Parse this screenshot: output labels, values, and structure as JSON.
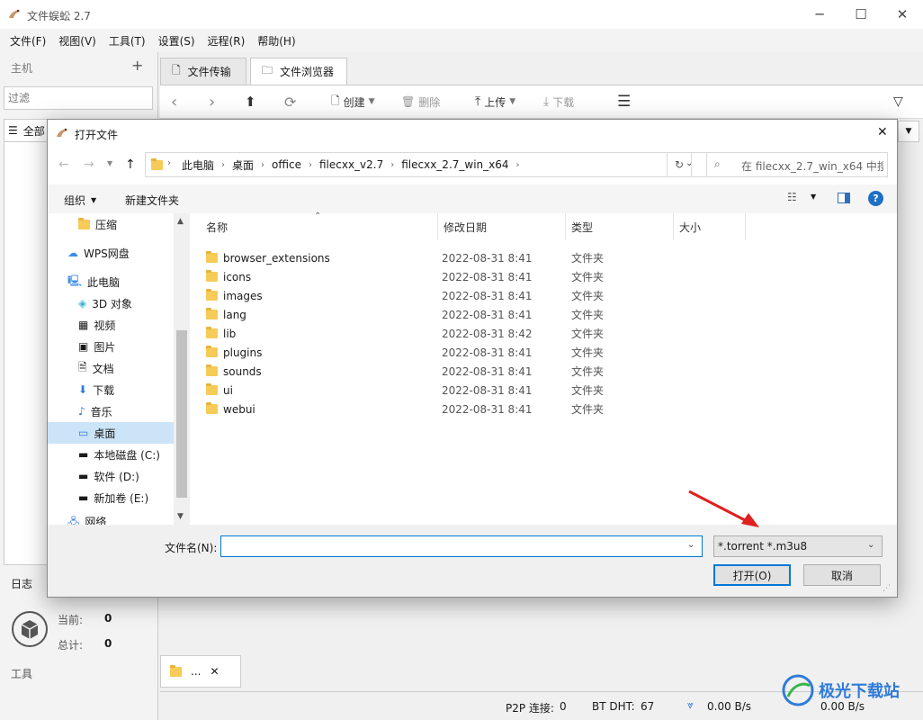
{
  "app": {
    "title": "文件蜈蚣 2.7",
    "menu": [
      "文件(F)",
      "视图(V)",
      "工具(T)",
      "设置(S)",
      "远程(R)",
      "帮助(H)"
    ],
    "left": {
      "host_label": "主机",
      "add_glyph": "+",
      "filter_placeholder": "过滤",
      "all_label": "全部",
      "log_label": "日志",
      "current_label": "当前:",
      "current_value": "0",
      "total_label": "总计:",
      "total_value": "0",
      "tools_label": "工具"
    },
    "tabs": [
      "文件传输",
      "文件浏览器"
    ],
    "toolbar": {
      "create": "创建",
      "delete": "删除",
      "upload": "上传",
      "download": "下载"
    },
    "bottom_tab": "...",
    "status": {
      "p2p_label": "P2P 连接:",
      "p2p_value": "0",
      "dht_label": "BT DHT:",
      "dht_value": "67",
      "down_speed": "0.00 B/s",
      "up_speed": "0.00 B/s"
    }
  },
  "dialog": {
    "title": "打开文件",
    "breadcrumbs": [
      "此电脑",
      "桌面",
      "office",
      "filecxx_v2.7",
      "filecxx_2.7_win_x64"
    ],
    "search_placeholder": "在 filecxx_2.7_win_x64 中搜...",
    "organize": "组织",
    "new_folder": "新建文件夹",
    "nav": [
      "压缩",
      "WPS网盘",
      "此电脑",
      "3D 对象",
      "视频",
      "图片",
      "文档",
      "下载",
      "音乐",
      "桌面",
      "本地磁盘 (C:)",
      "软件 (D:)",
      "新加卷 (E:)",
      "网络"
    ],
    "columns": {
      "name": "名称",
      "date": "修改日期",
      "type": "类型",
      "size": "大小"
    },
    "files": [
      {
        "name": "browser_extensions",
        "date": "2022-08-31 8:41",
        "type": "文件夹"
      },
      {
        "name": "icons",
        "date": "2022-08-31 8:41",
        "type": "文件夹"
      },
      {
        "name": "images",
        "date": "2022-08-31 8:41",
        "type": "文件夹"
      },
      {
        "name": "lang",
        "date": "2022-08-31 8:41",
        "type": "文件夹"
      },
      {
        "name": "lib",
        "date": "2022-08-31 8:42",
        "type": "文件夹"
      },
      {
        "name": "plugins",
        "date": "2022-08-31 8:41",
        "type": "文件夹"
      },
      {
        "name": "sounds",
        "date": "2022-08-31 8:41",
        "type": "文件夹"
      },
      {
        "name": "ui",
        "date": "2022-08-31 8:41",
        "type": "文件夹"
      },
      {
        "name": "webui",
        "date": "2022-08-31 8:41",
        "type": "文件夹"
      }
    ],
    "filename_label": "文件名(N):",
    "filename_value": "",
    "filter": "*.torrent *.m3u8",
    "open_button": "打开(O)",
    "cancel_button": "取消"
  },
  "watermark": "极光下载站",
  "colors": {
    "accent": "#0078d7",
    "selection": "#cce4f7",
    "folder": "#f6cb58",
    "arrow": "#e02020"
  }
}
